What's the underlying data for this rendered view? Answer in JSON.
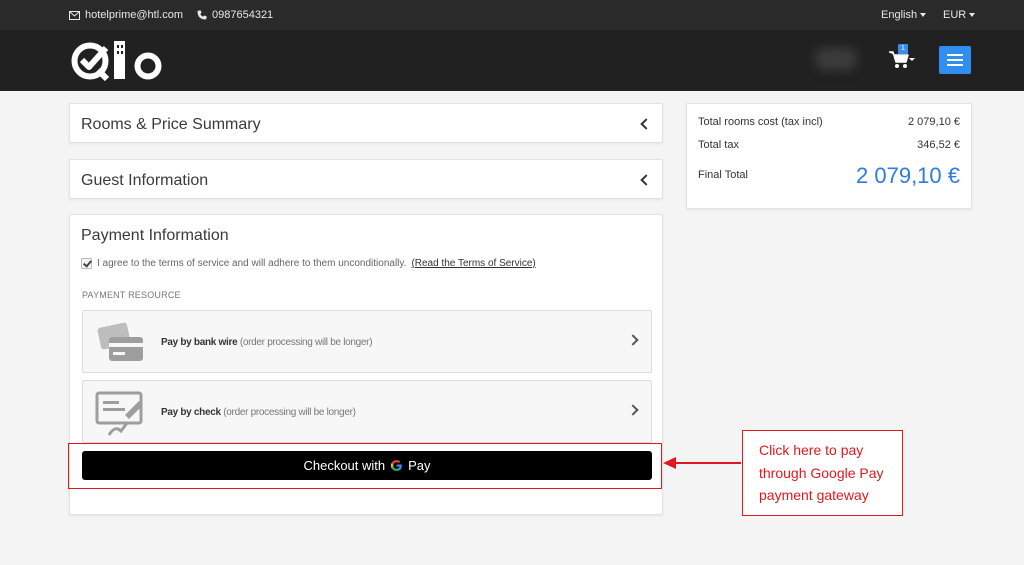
{
  "topbar": {
    "email": "hotelprime@htl.com",
    "phone": "0987654321",
    "language": "English",
    "currency": "EUR"
  },
  "header": {
    "logo_text": "Qlo",
    "cart_count": "1"
  },
  "sections": {
    "rooms_title": "Rooms & Price Summary",
    "guest_title": "Guest Information",
    "payment_title": "Payment Information"
  },
  "payment": {
    "terms_text": "I agree to the terms of service and will adhere to them unconditionally.",
    "terms_link": "(Read the Terms of Service)",
    "terms_checked": true,
    "resource_label": "PAYMENT RESOURCE",
    "options": [
      {
        "name": "Pay by bank wire",
        "note": " (order processing will be longer)",
        "icon": "bank-card-icon"
      },
      {
        "name": "Pay by check",
        "note": " (order processing will be longer)",
        "icon": "check-pen-icon"
      }
    ],
    "gpay_label": "Checkout with",
    "gpay_pay": "Pay"
  },
  "summary": {
    "rooms_cost_label": "Total rooms cost (tax incl)",
    "rooms_cost_value": "2 079,10 €",
    "tax_label": "Total tax",
    "tax_value": "346,52 €",
    "final_label": "Final Total",
    "final_value": "2 079,10 €"
  },
  "annotation": {
    "text": "Click here to pay through Google Pay payment gateway"
  },
  "colors": {
    "accent": "#2f8ff0",
    "total": "#2f7ae5",
    "annotation": "#e0191f",
    "topbar": "#2a2a2a",
    "header": "#212121"
  }
}
